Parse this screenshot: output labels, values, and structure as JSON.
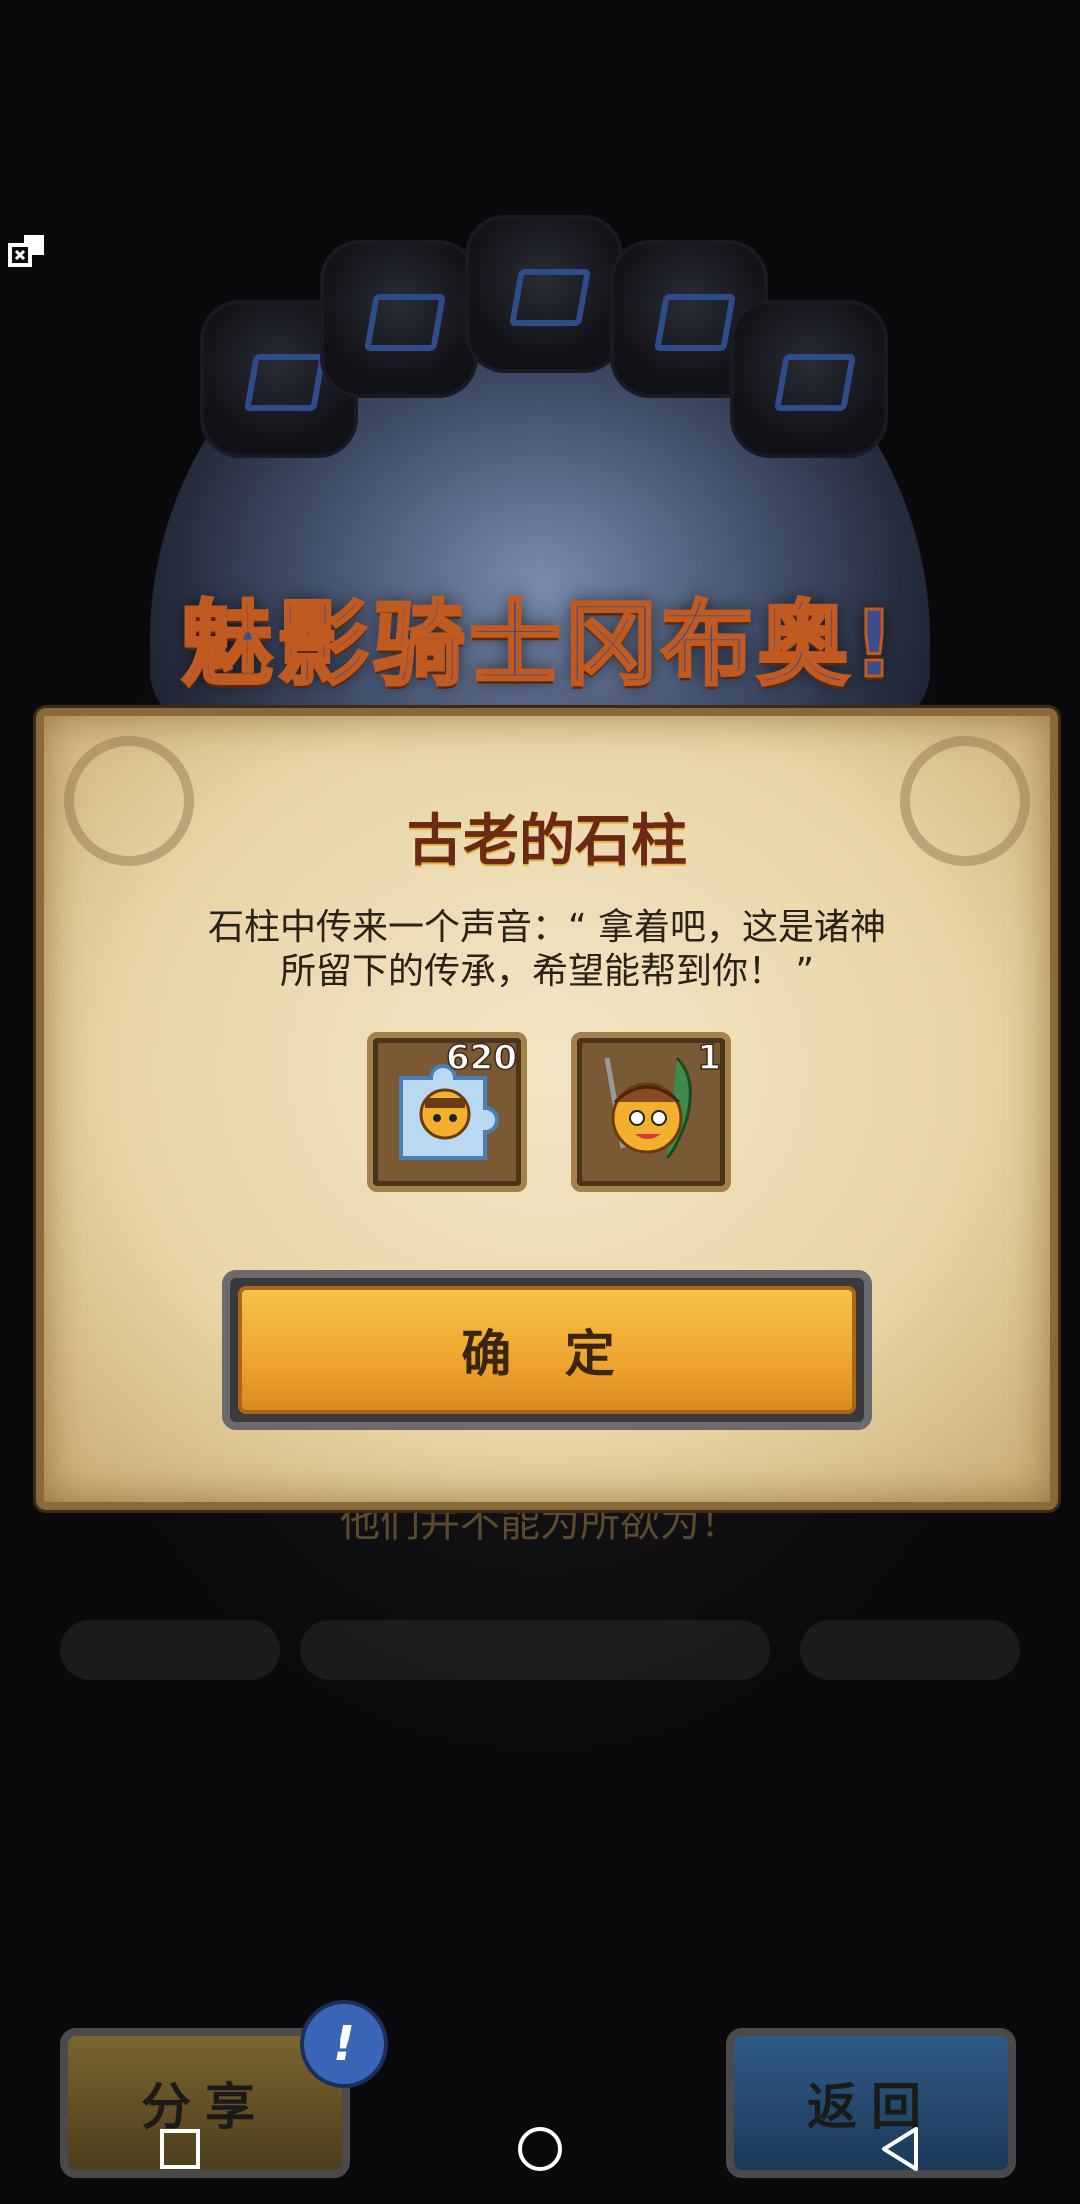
{
  "headline": "魅影骑士冈布奥!",
  "under_text": "他们并不能为所欲为！",
  "dialog": {
    "title": "古老的石柱",
    "body_line1": "石柱中传来一个声音：“ 拿着吧，这是诸神",
    "body_line2": "所留下的传承，希望能帮到你！ ”",
    "rewards": [
      {
        "icon": "puzzle-piece-icon",
        "count": "620"
      },
      {
        "icon": "knight-character-icon",
        "count": "1"
      }
    ],
    "confirm_label": "确 定"
  },
  "bottom": {
    "share_label": "分享",
    "back_label": "返回",
    "badge": "!"
  },
  "colors": {
    "dialog_bg": "#f3e6c6",
    "confirm_btn": "#f7c24a",
    "title_text": "#6b2a14"
  }
}
